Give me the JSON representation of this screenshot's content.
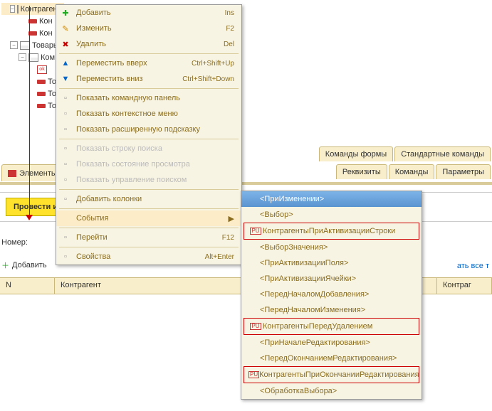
{
  "tree": {
    "items": [
      {
        "label": "Контрагенты",
        "icon": "table",
        "indent": 1,
        "exp": "-",
        "sel": true
      },
      {
        "label": "Кон",
        "icon": "bar",
        "indent": 2
      },
      {
        "label": "Кон",
        "icon": "bar",
        "indent": 2
      },
      {
        "label": "Товары",
        "icon": "table",
        "indent": 1,
        "exp": "-"
      },
      {
        "label": "Ком",
        "icon": "table",
        "indent": 2,
        "exp": "-"
      },
      {
        "label": "",
        "icon": "ok",
        "indent": 3
      },
      {
        "label": "То",
        "icon": "bar",
        "indent": 3
      },
      {
        "label": "То",
        "icon": "bar",
        "indent": 3
      },
      {
        "label": "То",
        "icon": "bar",
        "indent": 3
      }
    ]
  },
  "left_tabs": {
    "elements": "Элементы"
  },
  "right_tabs_top": {
    "forms": "Команды формы",
    "std": "Стандартные команды"
  },
  "right_tabs_bot": {
    "req": "Реквизиты",
    "cmd": "Команды",
    "param": "Параметры"
  },
  "header": {
    "provesti": "Провести и"
  },
  "nomer_label": "Номер:",
  "toolbar": {
    "add": "Добавить"
  },
  "right_link": "ать все т",
  "grid": {
    "n": "N",
    "kontragent": "Контрагент",
    "kontr_r": "Контраг"
  },
  "ctx": [
    {
      "label": "Добавить",
      "sc": "Ins",
      "ico": "add"
    },
    {
      "label": "Изменить",
      "sc": "F2",
      "ico": "edit"
    },
    {
      "label": "Удалить",
      "sc": "Del",
      "ico": "del"
    },
    {
      "sep": true
    },
    {
      "label": "Переместить вверх",
      "sc": "Ctrl+Shift+Up",
      "ico": "up"
    },
    {
      "label": "Переместить вниз",
      "sc": "Ctrl+Shift+Down",
      "ico": "dn"
    },
    {
      "sep": true
    },
    {
      "label": "Показать командную панель",
      "ico": "g"
    },
    {
      "label": "Показать контекстное меню",
      "ico": "g"
    },
    {
      "label": "Показать расширенную подсказку",
      "ico": "g"
    },
    {
      "sep": true
    },
    {
      "label": "Показать строку поиска",
      "dis": true,
      "ico": "g"
    },
    {
      "label": "Показать состояние просмотра",
      "dis": true,
      "ico": "g"
    },
    {
      "label": "Показать управление поиском",
      "dis": true,
      "ico": "g"
    },
    {
      "sep": true
    },
    {
      "label": "Добавить колонки",
      "ico": "g"
    },
    {
      "sep": true
    },
    {
      "label": "События",
      "arrow": true,
      "hl": true
    },
    {
      "sep": true
    },
    {
      "label": "Перейти",
      "sc": "F12",
      "ico": "g"
    },
    {
      "sep": true
    },
    {
      "label": "Свойства",
      "sc": "Alt+Enter",
      "ico": "g"
    }
  ],
  "sub": [
    {
      "label": "<ПриИзменении>",
      "top": true
    },
    {
      "label": "<Выбор>"
    },
    {
      "label": "КонтрагентыПриАктивизацииСтроки",
      "box": true,
      "pu": true
    },
    {
      "label": "<ВыборЗначения>"
    },
    {
      "label": "<ПриАктивизацииПоля>"
    },
    {
      "label": "<ПриАктивизацииЯчейки>"
    },
    {
      "label": "<ПередНачаломДобавления>"
    },
    {
      "label": "<ПередНачаломИзменения>"
    },
    {
      "label": "КонтрагентыПередУдалением",
      "box": true,
      "pu": true
    },
    {
      "label": "<ПриНачалеРедактирования>"
    },
    {
      "label": "<ПередОкончаниемРедактирования>"
    },
    {
      "label": "КонтрагентыПриОкончанииРедактирования",
      "box": true,
      "pu": true
    },
    {
      "label": "<ОбработкаВыбора>"
    }
  ]
}
